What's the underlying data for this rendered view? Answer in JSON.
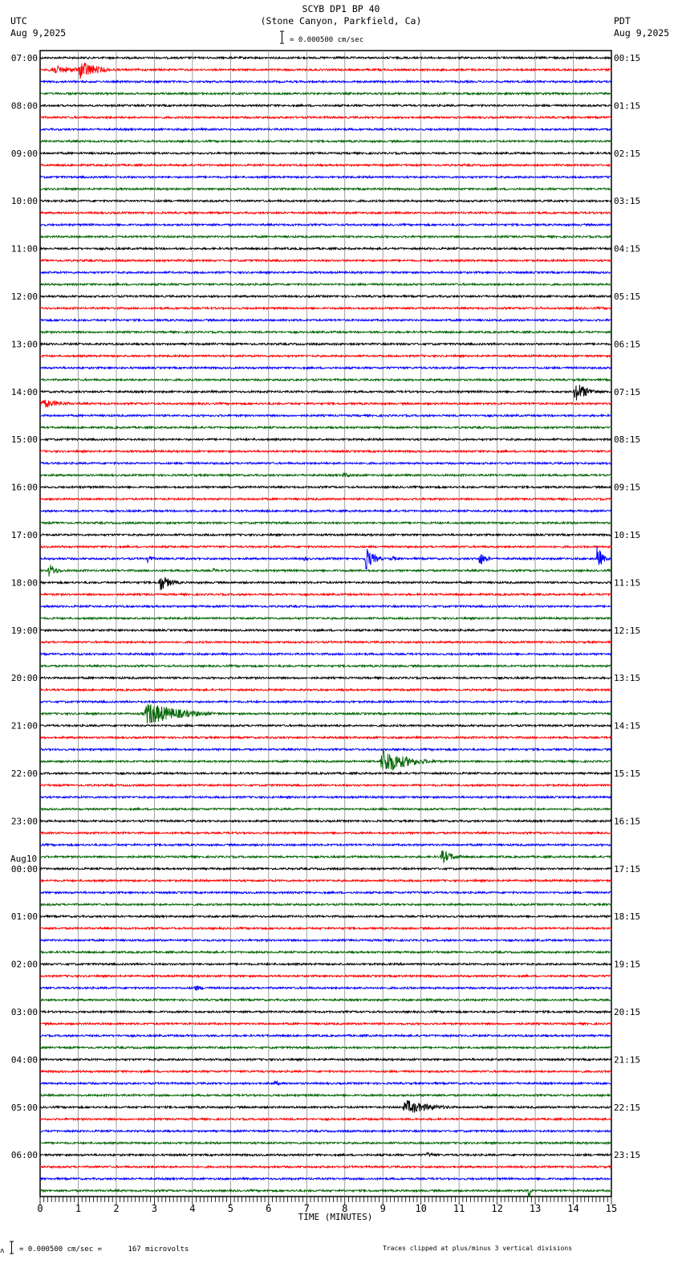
{
  "header": {
    "title": "SCYB DP1 BP 40",
    "subtitle": "(Stone Canyon, Parkfield, Ca)",
    "left_tz": "UTC",
    "left_date": "Aug 9,2025",
    "right_tz": "PDT",
    "right_date": "Aug 9,2025",
    "scale_label": "= 0.000500 cm/sec"
  },
  "footer": {
    "scale_note": "= 0.000500 cm/sec =      167 microvolts",
    "clip_note": "Traces clipped at plus/minus 3 vertical divisions"
  },
  "chart_data": {
    "type": "line",
    "title": "SCYB DP1 BP 40",
    "xlabel": "TIME (MINUTES)",
    "xlim": [
      0,
      15
    ],
    "x_ticks": [
      "0",
      "1",
      "2",
      "3",
      "4",
      "5",
      "6",
      "7",
      "8",
      "9",
      "10",
      "11",
      "12",
      "13",
      "14",
      "15"
    ],
    "trace_count": 96,
    "trace_colors": [
      "#000000",
      "#ff0000",
      "#0000ff",
      "#006400"
    ],
    "left_labels": [
      {
        "trace": 0,
        "text": "07:00"
      },
      {
        "trace": 4,
        "text": "08:00"
      },
      {
        "trace": 8,
        "text": "09:00"
      },
      {
        "trace": 12,
        "text": "10:00"
      },
      {
        "trace": 16,
        "text": "11:00"
      },
      {
        "trace": 20,
        "text": "12:00"
      },
      {
        "trace": 24,
        "text": "13:00"
      },
      {
        "trace": 28,
        "text": "14:00"
      },
      {
        "trace": 32,
        "text": "15:00"
      },
      {
        "trace": 36,
        "text": "16:00"
      },
      {
        "trace": 40,
        "text": "17:00"
      },
      {
        "trace": 44,
        "text": "18:00"
      },
      {
        "trace": 48,
        "text": "19:00"
      },
      {
        "trace": 52,
        "text": "20:00"
      },
      {
        "trace": 56,
        "text": "21:00"
      },
      {
        "trace": 60,
        "text": "22:00"
      },
      {
        "trace": 64,
        "text": "23:00"
      },
      {
        "trace": 68,
        "text": "00:00",
        "date": "Aug10"
      },
      {
        "trace": 72,
        "text": "01:00"
      },
      {
        "trace": 76,
        "text": "02:00"
      },
      {
        "trace": 80,
        "text": "03:00"
      },
      {
        "trace": 84,
        "text": "04:00"
      },
      {
        "trace": 88,
        "text": "05:00"
      },
      {
        "trace": 92,
        "text": "06:00"
      }
    ],
    "right_labels": [
      "00:15",
      "01:15",
      "02:15",
      "03:15",
      "04:15",
      "05:15",
      "06:15",
      "07:15",
      "08:15",
      "09:15",
      "10:15",
      "11:15",
      "12:15",
      "13:15",
      "14:15",
      "15:15",
      "16:15",
      "17:15",
      "18:15",
      "19:15",
      "20:15",
      "21:15",
      "22:15",
      "23:15"
    ],
    "events": [
      {
        "trace": 1,
        "minute": 0.2,
        "amp": 1.0,
        "dur": 2.3
      },
      {
        "trace": 1,
        "minute": 1.0,
        "amp": 2.2,
        "dur": 1.2
      },
      {
        "trace": 28,
        "minute": 14.0,
        "amp": 2.2,
        "dur": 1.0
      },
      {
        "trace": 29,
        "minute": 0.0,
        "amp": 1.0,
        "dur": 1.6
      },
      {
        "trace": 35,
        "minute": 7.9,
        "amp": 0.6,
        "dur": 1.0
      },
      {
        "trace": 42,
        "minute": 2.8,
        "amp": 1.0,
        "dur": 0.4
      },
      {
        "trace": 42,
        "minute": 6.9,
        "amp": 0.7,
        "dur": 0.4
      },
      {
        "trace": 42,
        "minute": 8.5,
        "amp": 3.0,
        "dur": 0.6
      },
      {
        "trace": 42,
        "minute": 9.2,
        "amp": 0.8,
        "dur": 0.4
      },
      {
        "trace": 42,
        "minute": 11.5,
        "amp": 1.8,
        "dur": 0.5
      },
      {
        "trace": 42,
        "minute": 14.6,
        "amp": 3.0,
        "dur": 0.4
      },
      {
        "trace": 43,
        "minute": 0.2,
        "amp": 1.6,
        "dur": 0.6
      },
      {
        "trace": 43,
        "minute": 4.5,
        "amp": 0.8,
        "dur": 0.3
      },
      {
        "trace": 44,
        "minute": 3.1,
        "amp": 2.0,
        "dur": 0.8
      },
      {
        "trace": 55,
        "minute": 2.7,
        "amp": 2.6,
        "dur": 2.5
      },
      {
        "trace": 59,
        "minute": 8.9,
        "amp": 3.0,
        "dur": 1.8
      },
      {
        "trace": 67,
        "minute": 10.5,
        "amp": 1.6,
        "dur": 0.9
      },
      {
        "trace": 78,
        "minute": 4.0,
        "amp": 0.7,
        "dur": 0.9
      },
      {
        "trace": 86,
        "minute": 6.1,
        "amp": 0.6,
        "dur": 0.8
      },
      {
        "trace": 88,
        "minute": 9.5,
        "amp": 1.6,
        "dur": 2.0
      },
      {
        "trace": 92,
        "minute": 10.1,
        "amp": 0.6,
        "dur": 0.9
      },
      {
        "trace": 95,
        "minute": 12.8,
        "amp": 3.0,
        "dur": 0.15
      }
    ]
  }
}
